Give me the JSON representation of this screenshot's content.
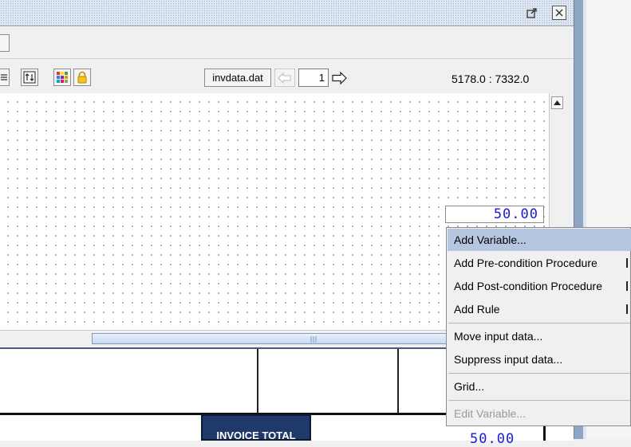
{
  "window": {
    "restore_icon": "restore-icon",
    "close_icon": "close-icon"
  },
  "toolbar": {
    "datafile": "invdata.dat",
    "page_number": "1",
    "coordinates": "5178.0 : 7332.0"
  },
  "canvas": {
    "selected_field_value": "50.00"
  },
  "context_menu": {
    "items": [
      {
        "label": "Add Variable...",
        "state": "selected"
      },
      {
        "label": "Add Pre-condition Procedure",
        "state": "enabled"
      },
      {
        "label": "Add Post-condition Procedure",
        "state": "enabled"
      },
      {
        "label": "Add Rule",
        "state": "enabled"
      },
      {
        "label": "Move input data...",
        "state": "enabled"
      },
      {
        "label": "Suppress input data...",
        "state": "enabled"
      },
      {
        "label": "Grid...",
        "state": "enabled"
      },
      {
        "label": "Edit Variable...",
        "state": "disabled"
      }
    ]
  },
  "preview": {
    "invoice_total_label": "INVOICE TOTAL",
    "partial_value": "50.00"
  },
  "colors": {
    "menu_highlight": "#b5c7e0",
    "field_text": "#1a1ad6",
    "header_fill": "#1f3a6a"
  }
}
